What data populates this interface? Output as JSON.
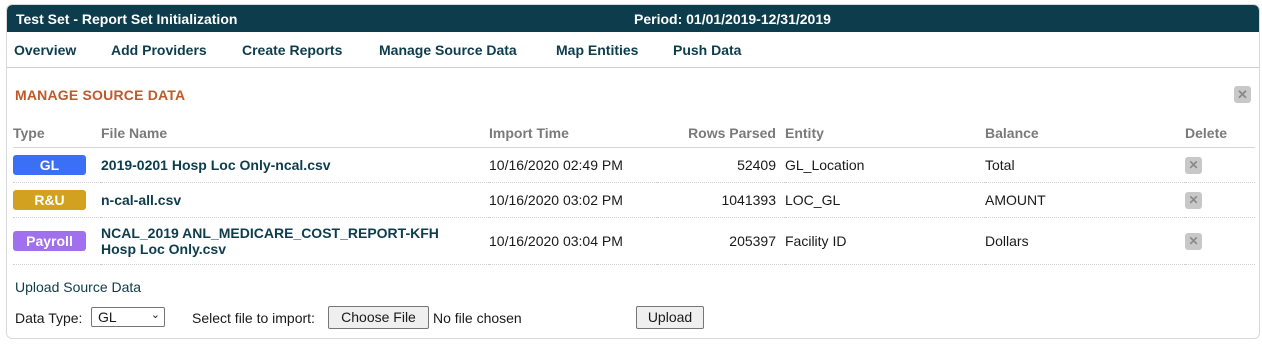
{
  "header": {
    "title": "Test Set - Report Set Initialization",
    "period": "Period: 01/01/2019-12/31/2019"
  },
  "nav": {
    "items": [
      {
        "label": "Overview"
      },
      {
        "label": "Add Providers"
      },
      {
        "label": "Create Reports"
      },
      {
        "label": "Manage Source Data"
      },
      {
        "label": "Map Entities"
      },
      {
        "label": "Push Data"
      }
    ]
  },
  "section": {
    "title": "MANAGE SOURCE DATA",
    "close_icon": "close-x-icon"
  },
  "table": {
    "columns": [
      "Type",
      "File Name",
      "Import Time",
      "Rows Parsed",
      "Entity",
      "Balance",
      "Delete"
    ],
    "rows": [
      {
        "type": "GL",
        "type_color": "#3b6ff5",
        "file": "2019-0201 Hosp Loc Only-ncal.csv",
        "time": "10/16/2020 02:49 PM",
        "rows": "52409",
        "entity": "GL_Location",
        "balance": "Total"
      },
      {
        "type": "R&U",
        "type_color": "#d2a11f",
        "file": "n-cal-all.csv",
        "time": "10/16/2020 03:02 PM",
        "rows": "1041393",
        "entity": "LOC_GL",
        "balance": "AMOUNT"
      },
      {
        "type": "Payroll",
        "type_color": "#a070ee",
        "file": "NCAL_2019 ANL_MEDICARE_COST_REPORT-KFH Hosp Loc Only.csv",
        "time": "10/16/2020 03:04 PM",
        "rows": "205397",
        "entity": "Facility ID",
        "balance": "Dollars"
      }
    ],
    "delete_icon": "delete-x-icon"
  },
  "upload": {
    "title": "Upload Source Data",
    "data_type_label": "Data Type:",
    "data_type_value": "GL",
    "file_label": "Select file to import:",
    "choose_button": "Choose File",
    "no_file": "No file chosen",
    "upload_button": "Upload"
  }
}
